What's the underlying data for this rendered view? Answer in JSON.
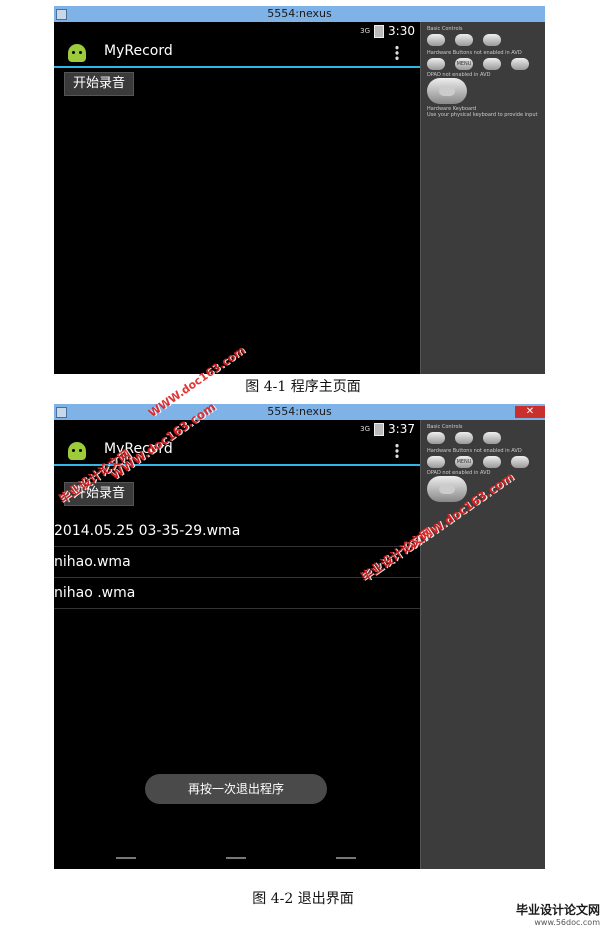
{
  "figure1": {
    "window_title": "5554:nexus",
    "status_time": "3:30",
    "signal": "3G",
    "app_title": "MyRecord",
    "record_button": "开始录音",
    "caption": "图 4-1 程序主页面"
  },
  "figure2": {
    "window_title": "5554:nexus",
    "status_time": "3:37",
    "signal": "3G",
    "app_title": "MyRecord",
    "record_button": "开始录音",
    "files": [
      "2014.05.25 03-35-29.wma",
      "nihao.wma",
      "nihao .wma"
    ],
    "toast": "再按一次退出程序",
    "caption": "图  4-2  退出界面"
  },
  "side_panel": {
    "basic_controls": "Basic Controls",
    "hardware_buttons": "Hardware Buttons not enabled in AVD",
    "dpad": "DPAD not enabled in AVD",
    "hardware_keyboard": "Hardware Keyboard",
    "keyboard_hint": "Use your physical keyboard to provide input",
    "menu_label": "MENU"
  },
  "watermarks": {
    "site": "WWW.doc163.com",
    "name": "毕业设计论文网"
  },
  "footer": {
    "logo_text": "毕业设计论文网",
    "logo_url": "www.56doc.com"
  }
}
